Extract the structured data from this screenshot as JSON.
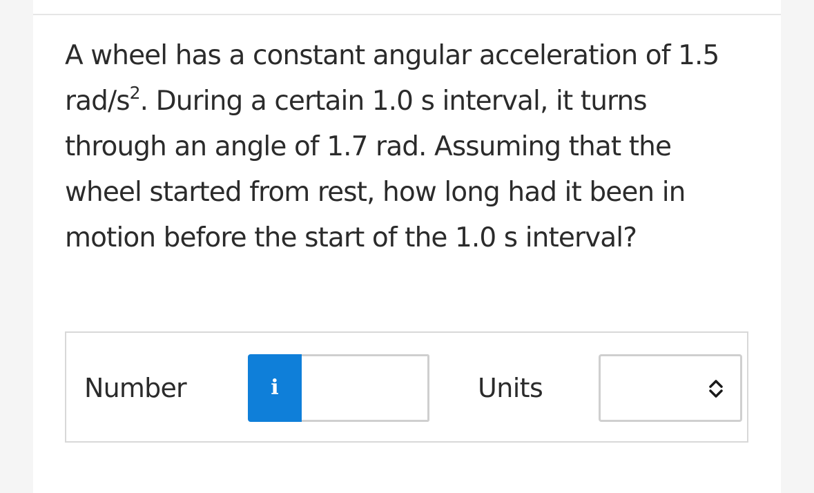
{
  "question": {
    "text_before_superscript": "A wheel has a constant angular acceleration of 1.5 rad/s",
    "superscript": "2",
    "text_after_superscript": ". During a certain 1.0 s interval, it turns through an angle of 1.7 rad. Assuming that the wheel started from rest, how long had it been in motion before the start of the 1.0 s interval?"
  },
  "answer": {
    "number_label": "Number",
    "info_button_label": "i",
    "number_value": "",
    "units_label": "Units",
    "units_value": ""
  },
  "colors": {
    "info_button": "#0f7fd9",
    "text": "#2b2b2b",
    "border": "#cfcfcf"
  },
  "icons": {
    "info": "info-icon",
    "select": "up-down-chevron-icon"
  }
}
